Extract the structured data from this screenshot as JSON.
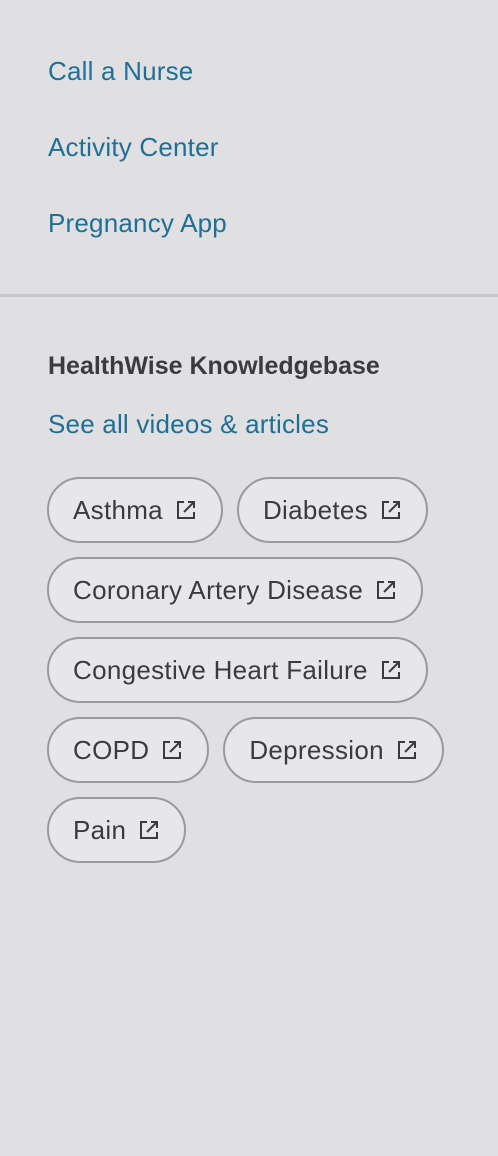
{
  "nav": {
    "items": [
      {
        "label": "Call a Nurse"
      },
      {
        "label": "Activity Center"
      },
      {
        "label": "Pregnancy App"
      }
    ]
  },
  "knowledgebase": {
    "heading": "HealthWise Knowledgebase",
    "see_all": "See all videos & articles",
    "topics": [
      {
        "label": "Asthma",
        "icon": "external-link-icon"
      },
      {
        "label": "Diabetes",
        "icon": "external-link-icon"
      },
      {
        "label": "Coronary Artery Disease",
        "icon": "external-link-icon"
      },
      {
        "label": "Congestive Heart Failure",
        "icon": "external-link-icon"
      },
      {
        "label": "COPD",
        "icon": "external-link-icon"
      },
      {
        "label": "Depression",
        "icon": "external-link-icon"
      },
      {
        "label": "Pain",
        "icon": "external-link-icon"
      }
    ]
  },
  "colors": {
    "background": "#e0e0e3",
    "link": "#1f6f94",
    "text": "#3b3b3e",
    "chip_border": "#9a9a9d",
    "chip_fill": "#e7e7e9",
    "divider": "#c8c8cb"
  }
}
